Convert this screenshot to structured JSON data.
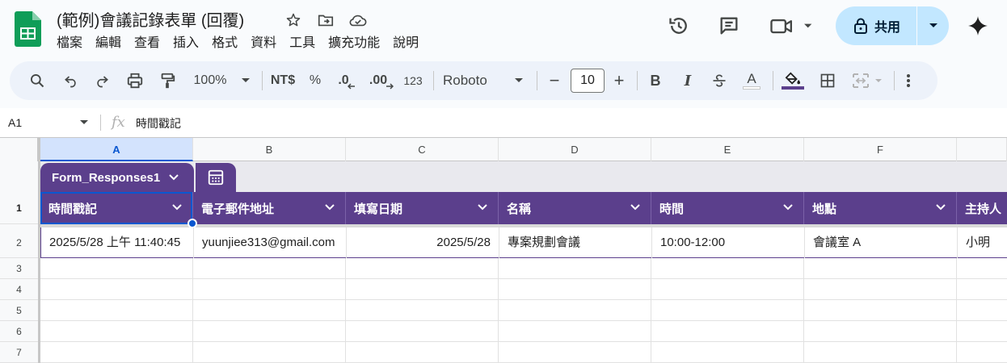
{
  "document": {
    "title": "(範例)會議記錄表單 (回覆)"
  },
  "menu": [
    "檔案",
    "編輯",
    "查看",
    "插入",
    "格式",
    "資料",
    "工具",
    "擴充功能",
    "說明"
  ],
  "share": {
    "label": "共用"
  },
  "toolbar": {
    "zoom": "100%",
    "currency": "NT$",
    "percent": "%",
    "dec_decrease": ".0",
    "dec_increase": ".00",
    "number_format": "123",
    "font": "Roboto",
    "font_size": "10",
    "minus": "−",
    "plus": "+",
    "bold": "B",
    "italic": "I",
    "text_color": "A"
  },
  "formula_bar": {
    "cell_ref": "A1",
    "fx": "fx",
    "value": "時間戳記"
  },
  "columns": [
    "A",
    "B",
    "C",
    "D",
    "E",
    "F"
  ],
  "rows": [
    "1",
    "2",
    "3",
    "4",
    "5",
    "6",
    "7"
  ],
  "table": {
    "name": "Form_Responses1",
    "headers": [
      "時間戳記",
      "電子郵件地址",
      "填寫日期",
      "名稱",
      "時間",
      "地點",
      "主持人"
    ],
    "row2": [
      "2025/5/28 上午 11:40:45",
      "yuunjiee313@gmail.com",
      "2025/5/28",
      "專案規劃會議",
      "10:00-12:00",
      "會議室 A",
      "小明"
    ]
  },
  "colors": {
    "accent": "#5b3f8c",
    "selection": "#0b57d0",
    "share_bg": "#c2e7ff"
  }
}
